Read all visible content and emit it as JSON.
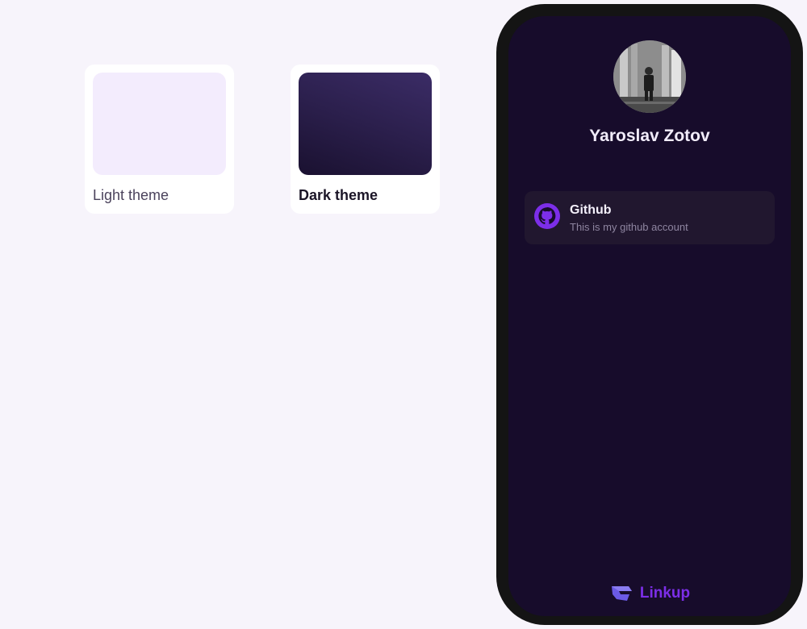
{
  "themes": {
    "light": {
      "label": "Light theme",
      "selected": false
    },
    "dark": {
      "label": "Dark theme",
      "selected": true
    }
  },
  "profile": {
    "name": "Yaroslav Zotov",
    "avatar": "avatar-photo"
  },
  "links": [
    {
      "title": "Github",
      "description": "This is my github account",
      "icon": "github-icon"
    }
  ],
  "brand": {
    "name": "Linkup",
    "logo": "linkup-logo-icon"
  },
  "colors": {
    "page_background": "#f7f4fb",
    "phone_screen_background": "#170c2b",
    "link_card_background": "#21172f",
    "accent": "#7c2ee8"
  }
}
